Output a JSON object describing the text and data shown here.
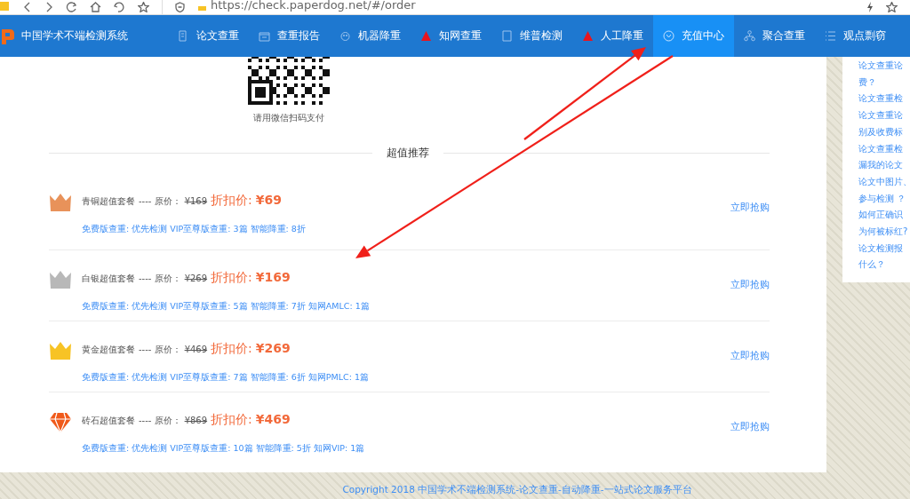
{
  "browser": {
    "url": "https://check.paperdog.net/#/order"
  },
  "nav": {
    "title": "中国学术不端检测系统",
    "items": [
      {
        "label": "论文查重",
        "selected": false
      },
      {
        "label": "查重报告",
        "selected": false
      },
      {
        "label": "机器降重",
        "selected": false
      },
      {
        "label": "知网查重",
        "selected": false
      },
      {
        "label": "维普检测",
        "selected": false
      },
      {
        "label": "人工降重",
        "selected": false
      },
      {
        "label": "充值中心",
        "selected": true
      },
      {
        "label": "聚合查重",
        "selected": false
      },
      {
        "label": "观点剽窃",
        "selected": false
      }
    ]
  },
  "payment": {
    "caption": "请用微信扫码支付"
  },
  "section_title": "超值推荐",
  "packages": [
    {
      "kind": "crown",
      "color": "#e8925a",
      "name": "青铜超值套餐",
      "separator": "---- 原价：",
      "original_price": "¥169",
      "discount_label": "折扣价:",
      "price": "¥69",
      "features": "免费版查重: 优先检测 VIP至尊版查重: 3篇 智能降重: 8折",
      "action": "立即抢购"
    },
    {
      "kind": "crown",
      "color": "#b8b8b8",
      "name": "白银超值套餐",
      "separator": "---- 原价：",
      "original_price": "¥269",
      "discount_label": "折扣价:",
      "price": "¥169",
      "features": "免费版查重: 优先检测 VIP至尊版查重: 5篇 智能降重: 7折 知网AMLC: 1篇",
      "action": "立即抢购"
    },
    {
      "kind": "crown",
      "color": "#f7c325",
      "name": "黄金超值套餐",
      "separator": "---- 原价：",
      "original_price": "¥469",
      "discount_label": "折扣价:",
      "price": "¥269",
      "features": "免费版查重: 优先检测 VIP至尊版查重: 7篇 智能降重: 6折 知网PMLC: 1篇",
      "action": "立即抢购"
    },
    {
      "kind": "diamond",
      "color": "#f05a1a",
      "name": "砖石超值套餐",
      "separator": "---- 原价：",
      "original_price": "¥869",
      "discount_label": "折扣价:",
      "price": "¥469",
      "features": "免费版查重: 优先检测 VIP至尊版查重: 10篇 智能降重: 5折 知网VIP: 1篇",
      "action": "立即抢购"
    }
  ],
  "sidebar": {
    "links": [
      "论文查重论",
      "费？",
      "论文查重检",
      "论文查重论",
      "别及收费标",
      "论文查重检",
      "漏我的论文",
      "论文中图片、",
      "参与检测 ？",
      "如何正确识",
      "为何被标红?",
      "论文检测报",
      "什么？"
    ]
  },
  "footer": {
    "copyright": "Copyright 2018 中国学术不端检测系统-论文查重-自动降重-一站式论文服务平台"
  },
  "annotations": [
    {
      "kind": "arrow"
    },
    {
      "kind": "arrow"
    }
  ]
}
